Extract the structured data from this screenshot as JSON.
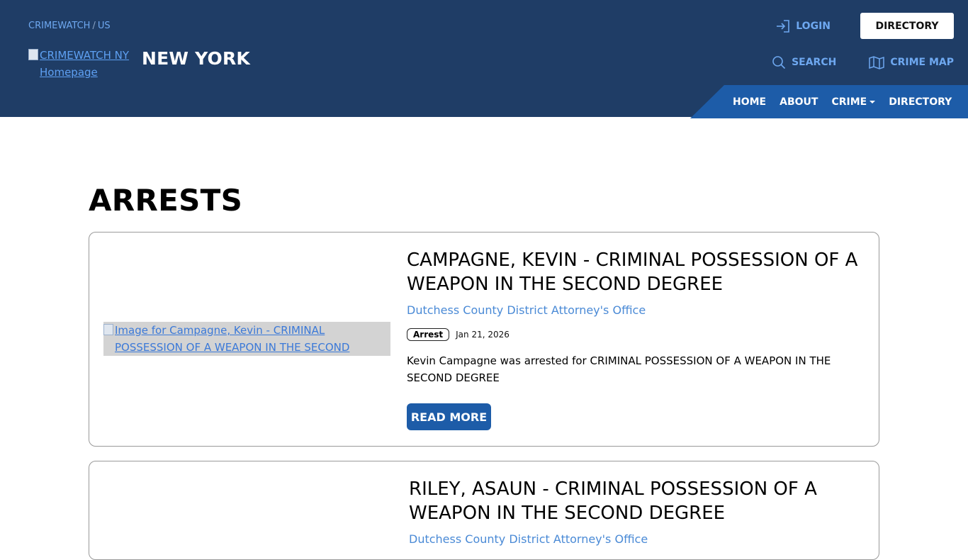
{
  "header": {
    "breadcrumb": [
      "CRIMEWATCH",
      "US"
    ],
    "logo_alt": "CRIMEWATCH NY Homepage",
    "site_name": "NEW YORK",
    "login_label": "LOGIN",
    "directory_button": "DIRECTORY",
    "search_label": "SEARCH",
    "crime_map_label": "CRIME MAP",
    "nav": [
      "HOME",
      "ABOUT",
      "CRIME",
      "DIRECTORY"
    ]
  },
  "main": {
    "title": "ARRESTS",
    "posts": [
      {
        "image_alt": "Image for Campagne, Kevin - CRIMINAL POSSESSION OF A WEAPON IN THE SECOND DEGREE",
        "title": "CAMPAGNE, KEVIN - CRIMINAL POSSESSION OF A WEAPON IN THE SECOND DEGREE",
        "agency": "Dutchess County District Attorney's Office",
        "tag": "Arrest",
        "date": "Jan 21, 2026",
        "summary": "Kevin Campagne was arrested for CRIMINAL POSSESSION OF A WEAPON IN THE SECOND DEGREE",
        "read_more": "READ MORE"
      },
      {
        "title": "RILEY, ASAUN - CRIMINAL POSSESSION OF A WEAPON IN THE SECOND DEGREE",
        "agency": "Dutchess County District Attorney's Office"
      }
    ]
  },
  "colors": {
    "header_bg": "#1f3d66",
    "nav_strip": "#1d5ca8",
    "link_blue": "#6ea8f0",
    "button_blue": "#1d5ca8"
  },
  "icons": [
    "login-icon",
    "search-icon",
    "map-icon",
    "caret-down-icon"
  ]
}
